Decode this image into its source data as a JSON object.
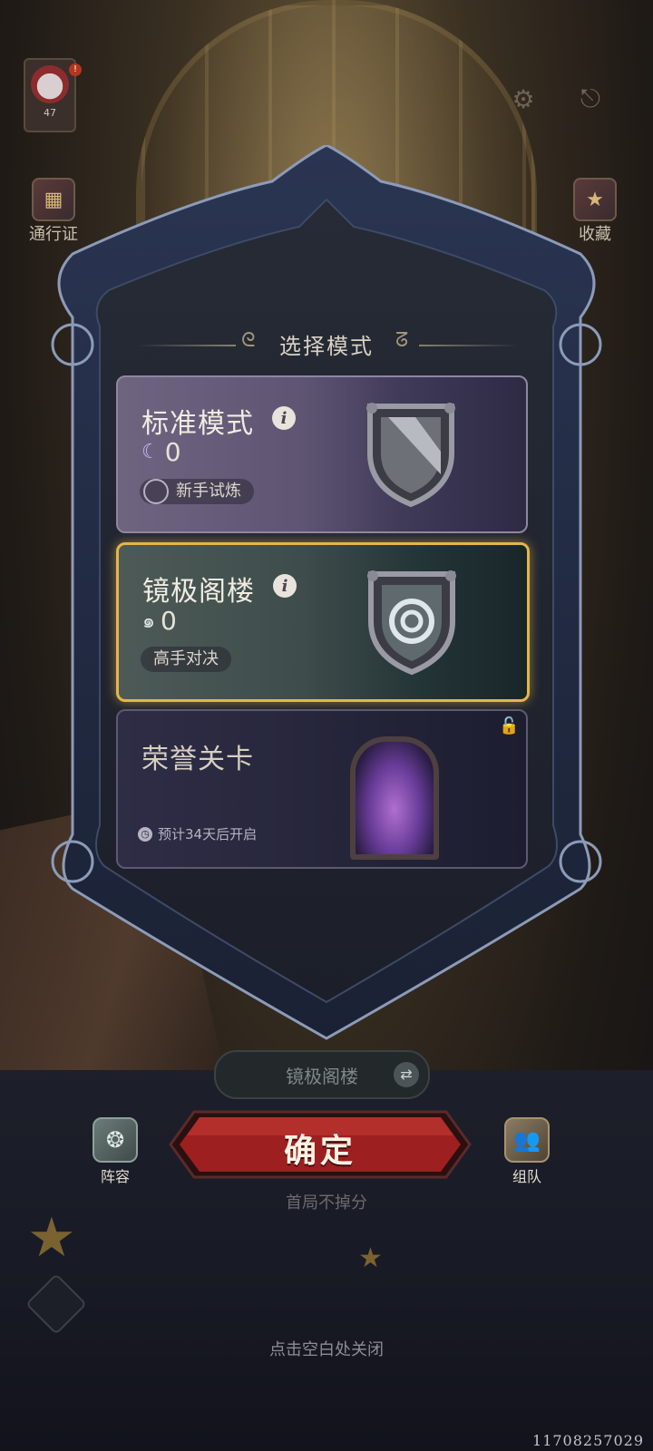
{
  "top": {
    "player_level": "47",
    "notification_badge": "!"
  },
  "left_sidebar": {
    "pass_label": "通行证"
  },
  "right_sidebar": {
    "collection_label": "收藏"
  },
  "panel": {
    "title": "选择模式",
    "modes": [
      {
        "name": "标准模式",
        "currency_value": "0",
        "tag": "新手试炼",
        "selected": false,
        "locked": false
      },
      {
        "name": "镜极阁楼",
        "currency_value": "0",
        "tag": "高手对决",
        "selected": true,
        "locked": false
      },
      {
        "name": "荣誉关卡",
        "timer_text": "预计34天后开启",
        "selected": false,
        "locked": true
      }
    ]
  },
  "bottom": {
    "current_mode": "镜极阁楼",
    "confirm_label": "确定",
    "lineup_label": "阵容",
    "team_label": "组队",
    "note": "首局不掉分",
    "close_hint": "点击空白处关闭",
    "corner_id": "11708257029"
  },
  "colors": {
    "selected_border": "#e4b54b",
    "confirm_red": "#9e1f1f",
    "frame_blue": "#1f2d48"
  },
  "icons": {
    "info": "info-icon",
    "lock": "lock-icon",
    "clock": "clock-icon",
    "swap": "swap-icon"
  }
}
